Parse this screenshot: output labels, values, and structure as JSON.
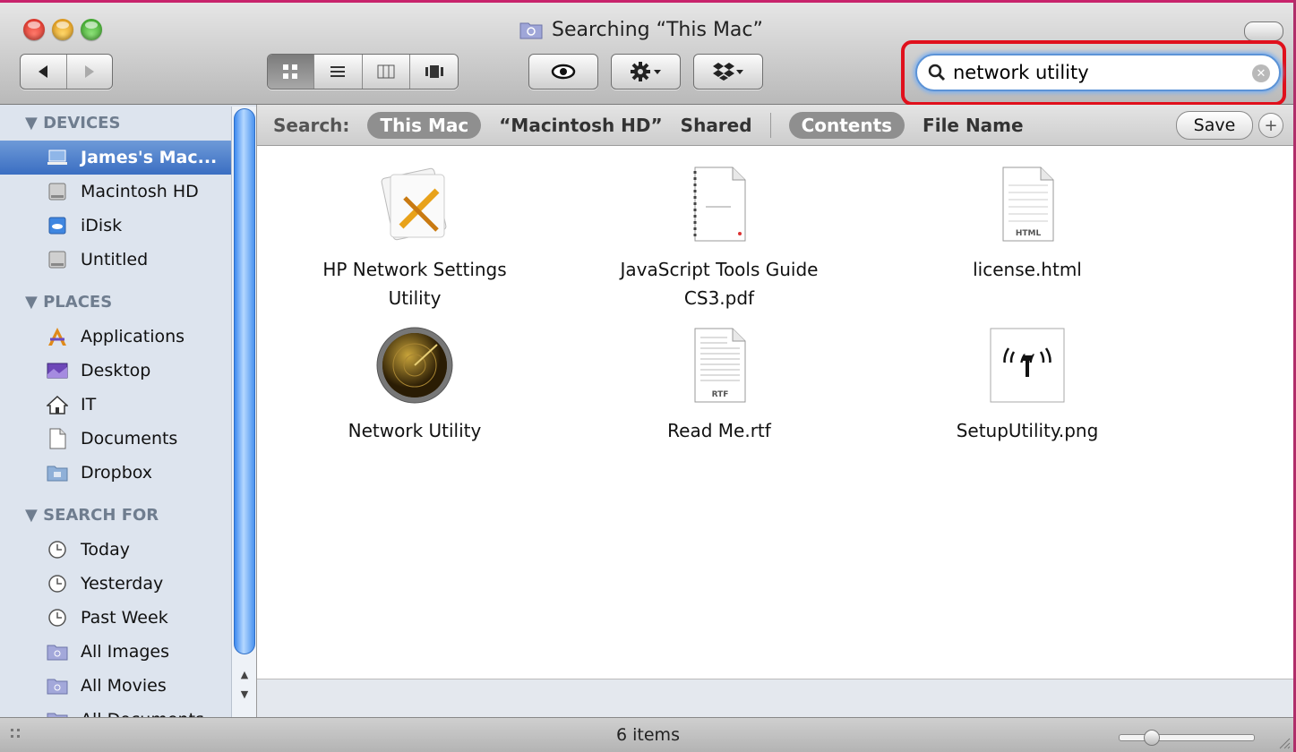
{
  "window": {
    "title": "Searching “This Mac”",
    "accent_color": "#3a6ec2",
    "highlight_color": "#e0101c"
  },
  "toolbar": {
    "back_icon": "back-arrow-icon",
    "forward_icon": "forward-arrow-icon",
    "view_modes": [
      "icon-view-icon",
      "list-view-icon",
      "column-view-icon",
      "coverflow-view-icon"
    ],
    "active_view_index": 0,
    "quicklook_icon": "eye-icon",
    "action_icon": "gear-icon",
    "dropbox_icon": "dropbox-icon"
  },
  "search": {
    "value": "network utility",
    "placeholder": ""
  },
  "sidebar": {
    "groups": [
      {
        "title": "DEVICES",
        "items": [
          {
            "label": "James's Mac...",
            "icon": "laptop-icon",
            "selected": true
          },
          {
            "label": "Macintosh HD",
            "icon": "hard-drive-icon"
          },
          {
            "label": "iDisk",
            "icon": "idisk-icon"
          },
          {
            "label": "Untitled",
            "icon": "hard-drive-icon"
          }
        ]
      },
      {
        "title": "PLACES",
        "items": [
          {
            "label": "Applications",
            "icon": "applications-icon"
          },
          {
            "label": "Desktop",
            "icon": "desktop-icon"
          },
          {
            "label": "IT",
            "icon": "home-icon"
          },
          {
            "label": "Documents",
            "icon": "documents-icon"
          },
          {
            "label": "Dropbox",
            "icon": "folder-icon"
          }
        ]
      },
      {
        "title": "SEARCH FOR",
        "items": [
          {
            "label": "Today",
            "icon": "clock-icon"
          },
          {
            "label": "Yesterday",
            "icon": "clock-icon"
          },
          {
            "label": "Past Week",
            "icon": "clock-icon"
          },
          {
            "label": "All Images",
            "icon": "smart-folder-icon"
          },
          {
            "label": "All Movies",
            "icon": "smart-folder-icon"
          },
          {
            "label": "All Documents",
            "icon": "smart-folder-icon"
          }
        ]
      }
    ]
  },
  "scope_bar": {
    "search_label": "Search:",
    "locations": [
      "This Mac",
      "“Macintosh HD”",
      "Shared"
    ],
    "active_location": 0,
    "kinds": [
      "Contents",
      "File Name"
    ],
    "active_kind": 0,
    "save_label": "Save",
    "add_label": "+"
  },
  "results": [
    {
      "name_line1": "HP Network Settings",
      "name_line2": "Utility",
      "icon": "app-utility-icon"
    },
    {
      "name_line1": "JavaScript Tools Guide",
      "name_line2": "CS3.pdf",
      "icon": "pdf-document-icon"
    },
    {
      "name_line1": "license.html",
      "name_line2": "",
      "icon": "html-document-icon"
    },
    {
      "name_line1": "Network Utility",
      "name_line2": "",
      "icon": "network-utility-radar-icon"
    },
    {
      "name_line1": "Read Me.rtf",
      "name_line2": "",
      "icon": "rtf-document-icon"
    },
    {
      "name_line1": "SetupUtility.png",
      "name_line2": "",
      "icon": "wireless-image-icon"
    }
  ],
  "status": {
    "item_count": "6 items",
    "icon_size_fraction": 0.2
  },
  "file_badges": {
    "html": "HTML",
    "rtf": "RTF"
  }
}
